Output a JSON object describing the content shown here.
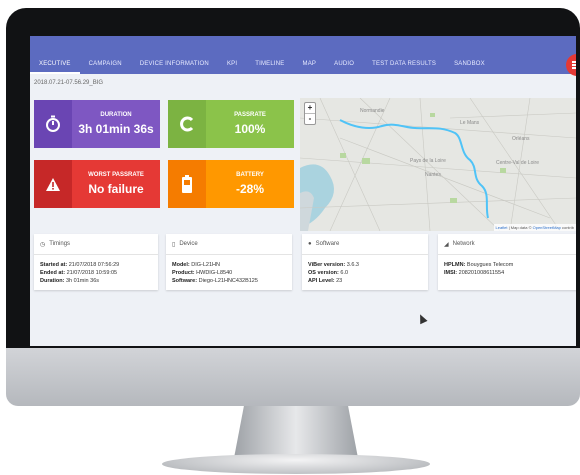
{
  "tabs": [
    "XECUTIVE",
    "CAMPAIGN",
    "DEVICE INFORMATION",
    "KPI",
    "TIMELINE",
    "MAP",
    "AUDIO",
    "TEST DATA RESULTS",
    "SANDBOX"
  ],
  "breadcrumb": "2018.07.21-07.56.29_BIG",
  "stats": {
    "duration": {
      "label": "DURATION",
      "value": "3h 01min 36s",
      "icon": "stopwatch-icon",
      "color": "#7e57c2"
    },
    "passrate": {
      "label": "PASSRATE",
      "value": "100%",
      "icon": "gauge-icon",
      "color": "#8bc34a"
    },
    "worst": {
      "label": "WORST PASSRATE",
      "value": "No failure",
      "icon": "warning-icon",
      "color": "#e53935"
    },
    "battery": {
      "label": "BATTERY",
      "value": "-28%",
      "icon": "battery-icon",
      "color": "#ff9800"
    }
  },
  "map": {
    "zoom_in": "+",
    "zoom_out": "-",
    "attribution_leaflet": "Leaflet",
    "attribution_rest": " | Map data © ",
    "attribution_osm": "OpenStreetMap",
    "attribution_end": " contrib",
    "route_color": "#4fc3f7"
  },
  "timings": {
    "title": "Timings",
    "started_label": "Started at:",
    "started": "21/07/2018 07:56:29",
    "ended_label": "Ended at:",
    "ended": "21/07/2018 10:59:05",
    "duration_label": "Duration:",
    "duration": "3h 01min 36s"
  },
  "device": {
    "title": "Device",
    "model_label": "Model:",
    "model": "DIG-L21HN",
    "product_label": "Product:",
    "product": "HWDIG-L8540",
    "software_label": "Software:",
    "software": "Diego-L21HNC432B125"
  },
  "software": {
    "title": "Software",
    "viber_label": "ViBer version:",
    "viber": "3.6.3",
    "os_label": "OS version:",
    "os": "6.0",
    "api_label": "API Level:",
    "api": "23"
  },
  "network": {
    "title": "Network",
    "hplmn_label": "HPLMN:",
    "hplmn": "Bouygues Telecom",
    "imsi_label": "IMSI:",
    "imsi": "208201008611554"
  }
}
